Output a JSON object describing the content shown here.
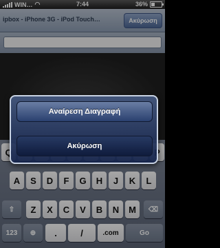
{
  "status_bar": {
    "carrier": "WIN…",
    "time": "7:44",
    "battery_percent": "36%",
    "battery_level": 0.36,
    "icons": {
      "signal": "signal-bars-icon",
      "wifi": "wifi-icon",
      "battery": "battery-icon"
    }
  },
  "navbar": {
    "title": "ipbox - iPhone 3G - iPod Touch…",
    "cancel_label": "Ακύρωση"
  },
  "search": {
    "value": "",
    "placeholder": ""
  },
  "action_sheet": {
    "primary_label": "Αναίρεση Διαγραφή",
    "cancel_label": "Ακύρωση"
  },
  "keyboard": {
    "row1": [
      "Q",
      "W",
      "E",
      "R",
      "T",
      "Y",
      "U",
      "I",
      "O",
      "P"
    ],
    "row2": [
      "A",
      "S",
      "D",
      "F",
      "G",
      "H",
      "J",
      "K",
      "L"
    ],
    "row3": [
      "Z",
      "X",
      "C",
      "V",
      "B",
      "N",
      "M"
    ],
    "shift_icon": "shift-icon",
    "delete_icon": "delete-key-icon",
    "globe_icon": "globe-icon",
    "numbers_label": "123",
    "dot_label": ".",
    "slash_label": "/",
    "com_label": ".com",
    "go_label": "Go"
  }
}
